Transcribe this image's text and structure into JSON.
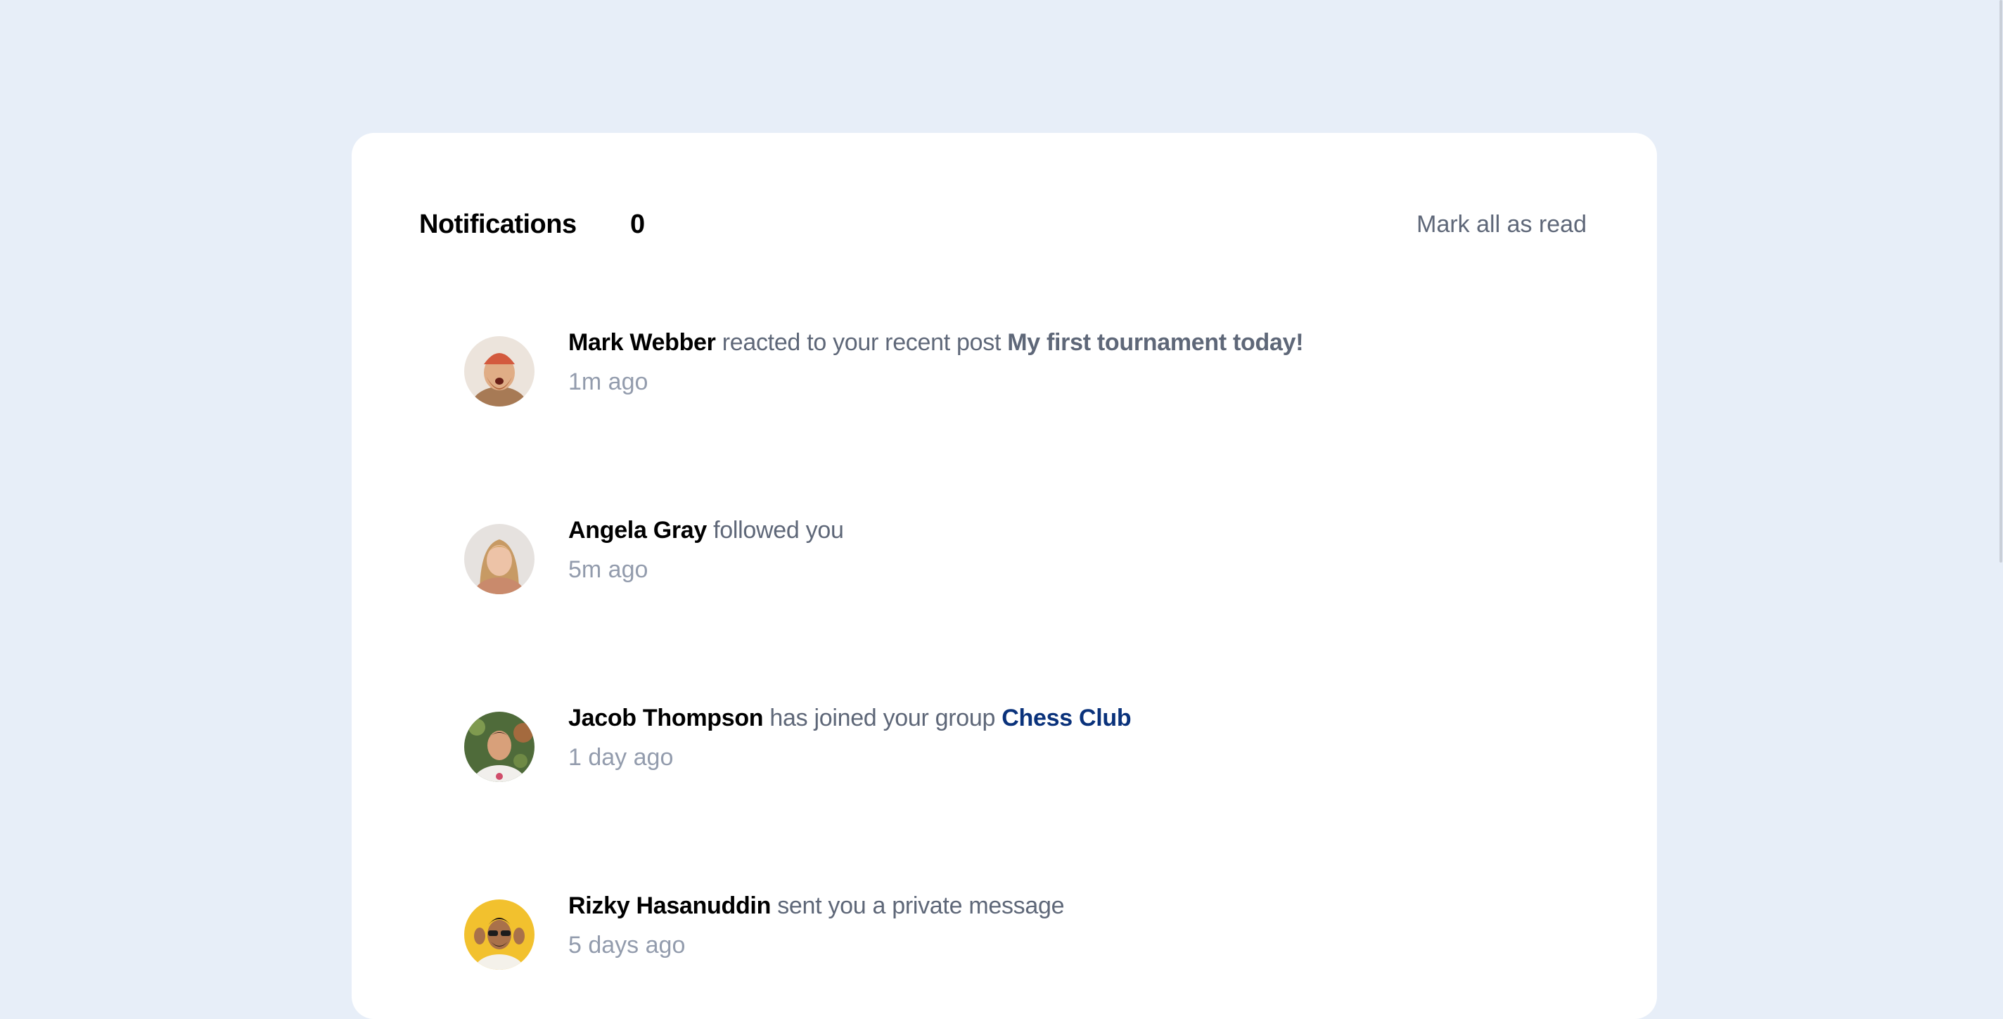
{
  "header": {
    "title": "Notifications",
    "count": "0",
    "mark_all": "Mark all as read"
  },
  "notifications": [
    {
      "name": "Mark Webber",
      "action": " reacted to your recent post ",
      "target": "My first tournament today!",
      "time": "1m ago"
    },
    {
      "name": "Angela Gray",
      "action": " followed you",
      "target": "",
      "time": "5m ago"
    },
    {
      "name": "Jacob Thompson",
      "action": " has joined your group ",
      "target": "Chess Club",
      "time": "1 day ago"
    },
    {
      "name": "Rizky Hasanuddin",
      "action": " sent you a private message",
      "target": "",
      "time": "5 days ago"
    }
  ],
  "colors": {
    "background": "#e7eef8",
    "card": "#ffffff",
    "name": "#000000",
    "muted": "#5e6778",
    "time": "#939cad",
    "group_link": "#0a327b"
  }
}
